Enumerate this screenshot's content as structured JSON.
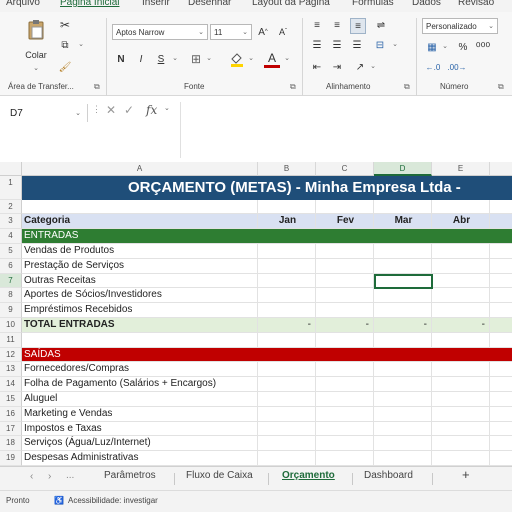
{
  "menu": {
    "tabs": [
      "Arquivo",
      "Página Inicial",
      "Inserir",
      "Desenhar",
      "Layout da Página",
      "Fórmulas",
      "Dados",
      "Revisão"
    ],
    "active": "Página Inicial"
  },
  "ribbon": {
    "clipboard": {
      "paste_label": "Colar",
      "group_label": "Área de Transfer..."
    },
    "font": {
      "font_name": "Aptos Narrow",
      "font_size": "11",
      "bold": "N",
      "italic": "I",
      "underline": "S",
      "group_label": "Fonte"
    },
    "alignment": {
      "group_label": "Alinhamento"
    },
    "number": {
      "format": "Personalizado",
      "group_label": "Número"
    }
  },
  "formula_bar": {
    "name_box": "D7",
    "fx": "fx",
    "value": ""
  },
  "grid": {
    "columns": [
      "A",
      "B",
      "C",
      "D",
      "E"
    ],
    "selected_column": "D",
    "selected_row": "7",
    "title": "ORÇAMENTO (METAS) - Minha Empresa Ltda -",
    "header": {
      "categoria": "Categoria",
      "months": [
        "Jan",
        "Fev",
        "Mar",
        "Abr"
      ]
    },
    "rows": [
      {
        "n": "1",
        "type": "title"
      },
      {
        "n": "2",
        "type": "blank"
      },
      {
        "n": "3",
        "type": "header"
      },
      {
        "n": "4",
        "type": "green",
        "label": "ENTRADAS"
      },
      {
        "n": "5",
        "type": "item",
        "label": "Vendas de Produtos"
      },
      {
        "n": "6",
        "type": "item",
        "label": "Prestação de Serviços"
      },
      {
        "n": "7",
        "type": "item",
        "label": "Outras Receitas"
      },
      {
        "n": "8",
        "type": "item",
        "label": "Aportes de Sócios/Investidores"
      },
      {
        "n": "9",
        "type": "item",
        "label": "Empréstimos Recebidos"
      },
      {
        "n": "10",
        "type": "total",
        "label": "TOTAL ENTRADAS",
        "values": [
          "-",
          "-",
          "-",
          "-"
        ]
      },
      {
        "n": "11",
        "type": "blank"
      },
      {
        "n": "12",
        "type": "red",
        "label": "SAÍDAS"
      },
      {
        "n": "13",
        "type": "item",
        "label": "Fornecedores/Compras"
      },
      {
        "n": "14",
        "type": "item",
        "label": "Folha de Pagamento (Salários + Encargos)"
      },
      {
        "n": "15",
        "type": "item",
        "label": "Aluguel"
      },
      {
        "n": "16",
        "type": "item",
        "label": "Marketing e Vendas"
      },
      {
        "n": "17",
        "type": "item",
        "label": "Impostos e Taxas"
      },
      {
        "n": "18",
        "type": "item",
        "label": "Serviços (Água/Luz/Internet)"
      },
      {
        "n": "19",
        "type": "item",
        "label": "Despesas Administrativas"
      }
    ]
  },
  "sheet_tabs": {
    "tabs": [
      "Parâmetros",
      "Fluxo de Caixa",
      "Orçamento",
      "Dashboard"
    ],
    "active": "Orçamento",
    "add_label": "+",
    "more_label": "..."
  },
  "status_bar": {
    "ready": "Pronto",
    "accessibility": "Acessibilidade: investigar"
  },
  "colors": {
    "title_bg": "#1f4e79",
    "header_bg": "#d9e1f2",
    "entradas_bg": "#2e7d32",
    "total_bg": "#e2efda",
    "saidas_bg": "#c00000",
    "accent": "#1e6b3a"
  }
}
